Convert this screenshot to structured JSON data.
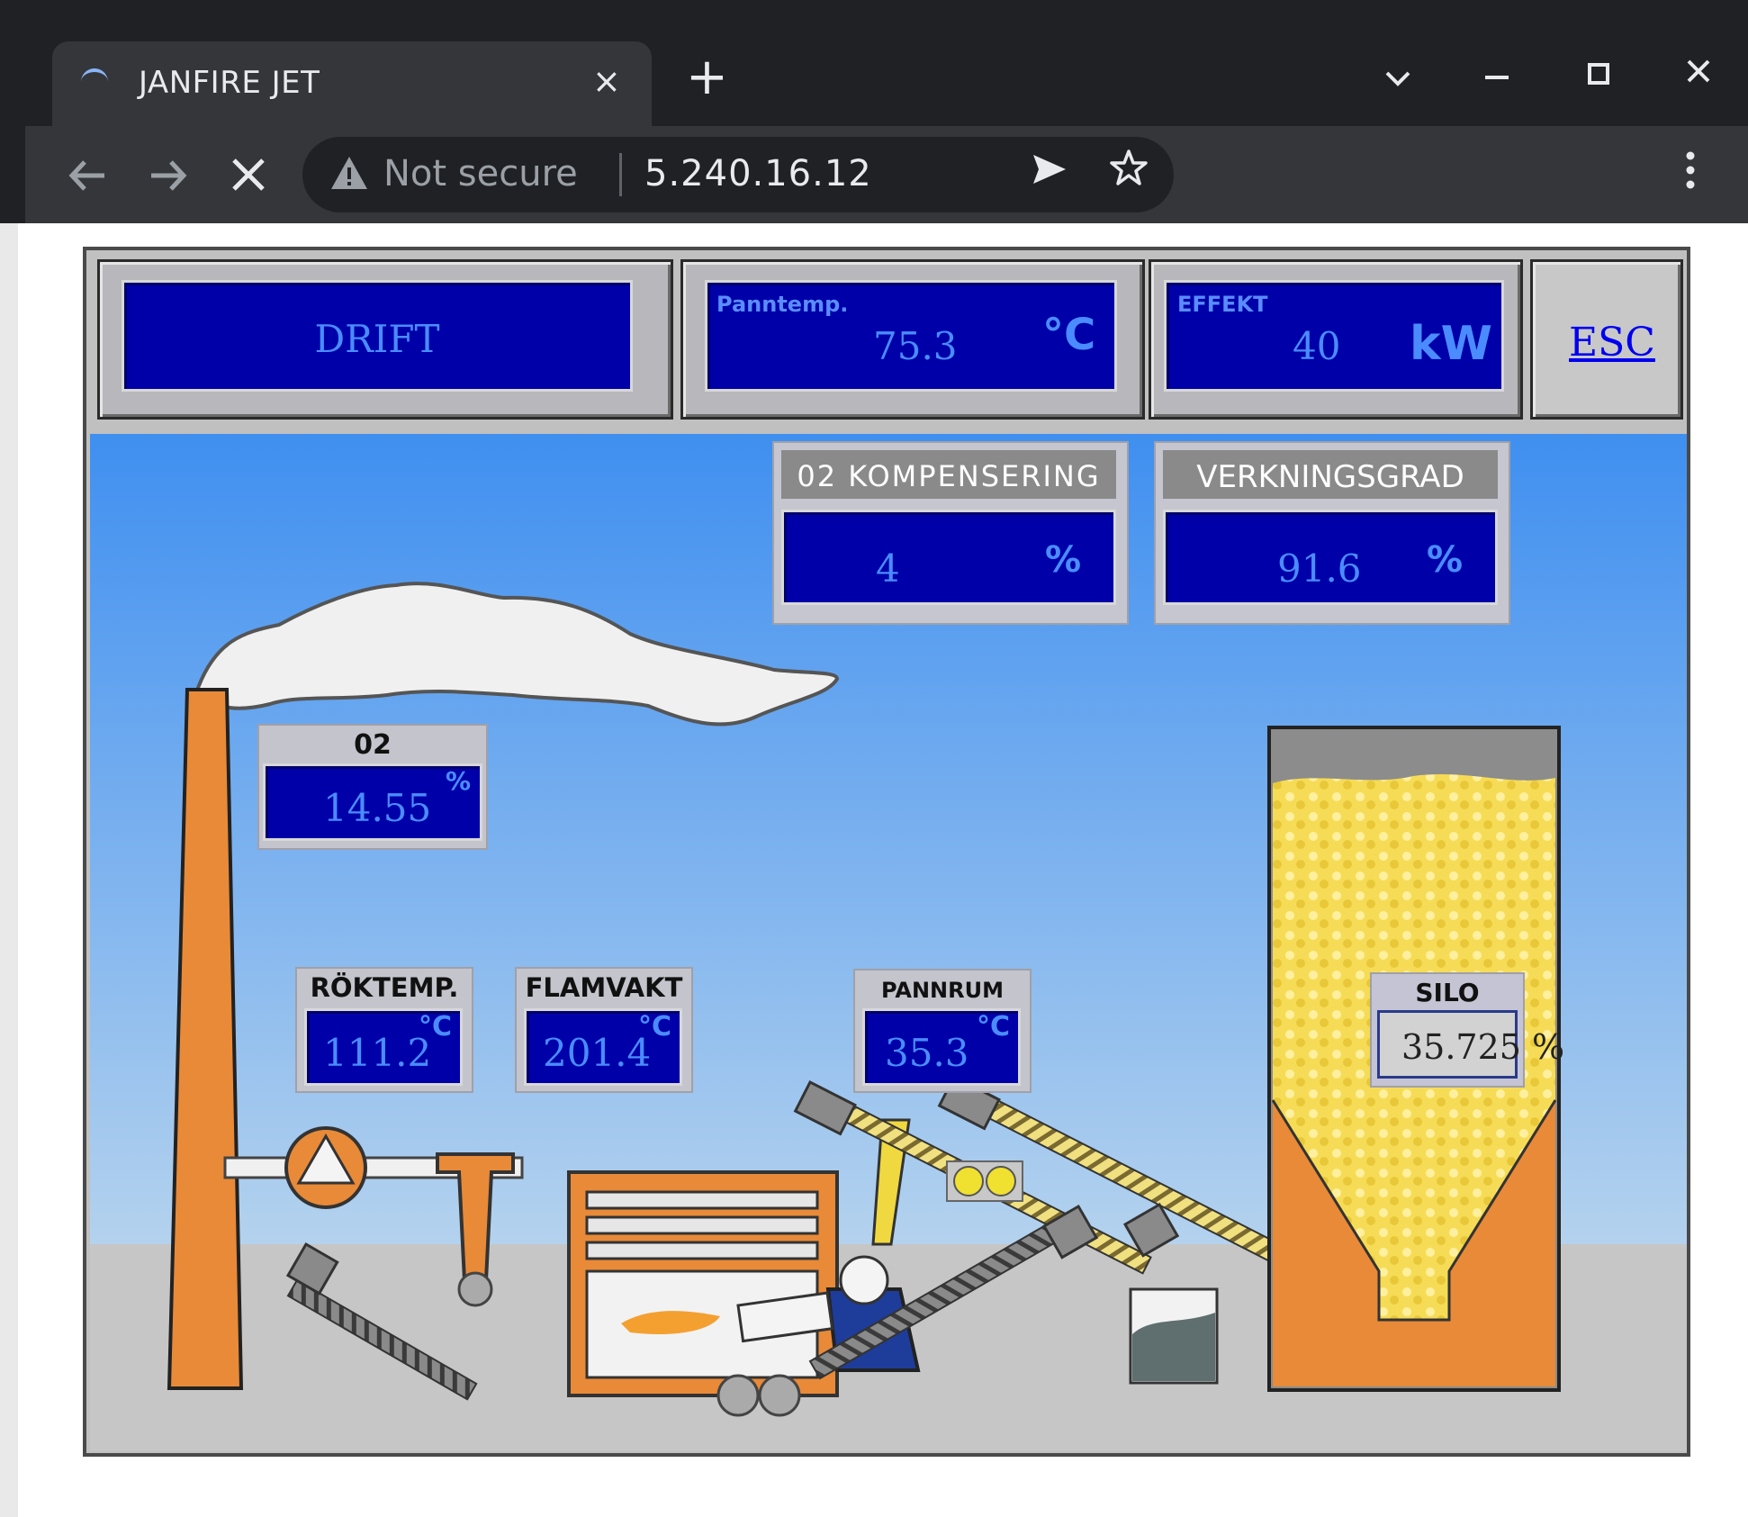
{
  "browser": {
    "tab_title": "JANFIRE JET",
    "tab_close": "×",
    "new_tab": "+",
    "security_label": "Not secure",
    "url": "5.240.16.12",
    "window_controls": [
      "chevron-down-icon",
      "minimize-icon",
      "maximize-icon",
      "close-icon"
    ]
  },
  "status": {
    "state": "DRIFT",
    "esc_label": "ESC"
  },
  "panntemp": {
    "label": "Panntemp.",
    "value": "75.3",
    "unit": "°C"
  },
  "effekt": {
    "label": "EFFEKT",
    "value": "40",
    "unit": "kW"
  },
  "o2_komp": {
    "label": "02 KOMPENSERING",
    "value": "4",
    "unit": "%"
  },
  "verkningsgrad": {
    "label": "VERKNINGSGRAD",
    "value": "91.6",
    "unit": "%"
  },
  "o2": {
    "label": "02",
    "value": "14.55",
    "unit": "%"
  },
  "roktemp": {
    "label": "RÖKTEMP.",
    "value": "111.2",
    "unit": "°C"
  },
  "flamvakt": {
    "label": "FLAMVAKT",
    "value": "201.4",
    "unit": "°C"
  },
  "pannrum": {
    "label": "PANNRUM",
    "value": "35.3",
    "unit": "°C"
  },
  "silo": {
    "label": "SILO",
    "value": "35.725 %",
    "level_percent": 35.725
  },
  "colors": {
    "sky_top": "#3f8ff0",
    "sky_bottom": "#a8cdf0",
    "lcd_bg": "#0000a8",
    "lcd_text": "#4a8cff",
    "orange": "#e88a38",
    "pellet": "#f4d850"
  }
}
